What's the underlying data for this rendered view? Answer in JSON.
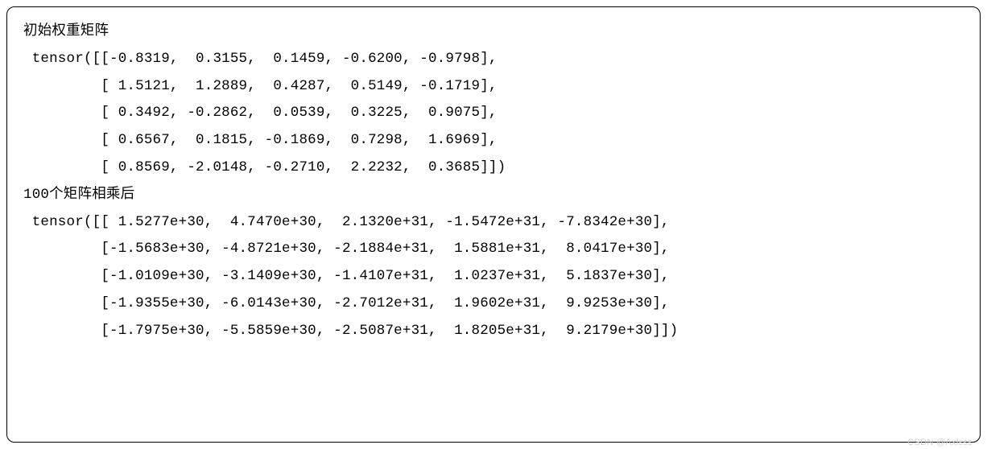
{
  "header1": "初始权重矩阵",
  "tensor1": {
    "line1": " tensor([[-0.8319,  0.3155,  0.1459, -0.6200, -0.9798],",
    "line2": "         [ 1.5121,  1.2889,  0.4287,  0.5149, -0.1719],",
    "line3": "         [ 0.3492, -0.2862,  0.0539,  0.3225,  0.9075],",
    "line4": "         [ 0.6567,  0.1815, -0.1869,  0.7298,  1.6969],",
    "line5": "         [ 0.8569, -2.0148, -0.2710,  2.2232,  0.3685]])"
  },
  "header2": "100个矩阵相乘后",
  "tensor2": {
    "line1": " tensor([[ 1.5277e+30,  4.7470e+30,  2.1320e+31, -1.5472e+31, -7.8342e+30],",
    "line2": "         [-1.5683e+30, -4.8721e+30, -2.1884e+31,  1.5881e+31,  8.0417e+30],",
    "line3": "         [-1.0109e+30, -3.1409e+30, -1.4107e+31,  1.0237e+31,  5.1837e+30],",
    "line4": "         [-1.9355e+30, -6.0143e+30, -2.7012e+31,  1.9602e+31,  9.9253e+30],",
    "line5": "         [-1.7975e+30, -5.5859e+30, -2.5087e+31,  1.8205e+31,  9.2179e+30]])"
  },
  "watermark": "CSDN @Axlsss"
}
